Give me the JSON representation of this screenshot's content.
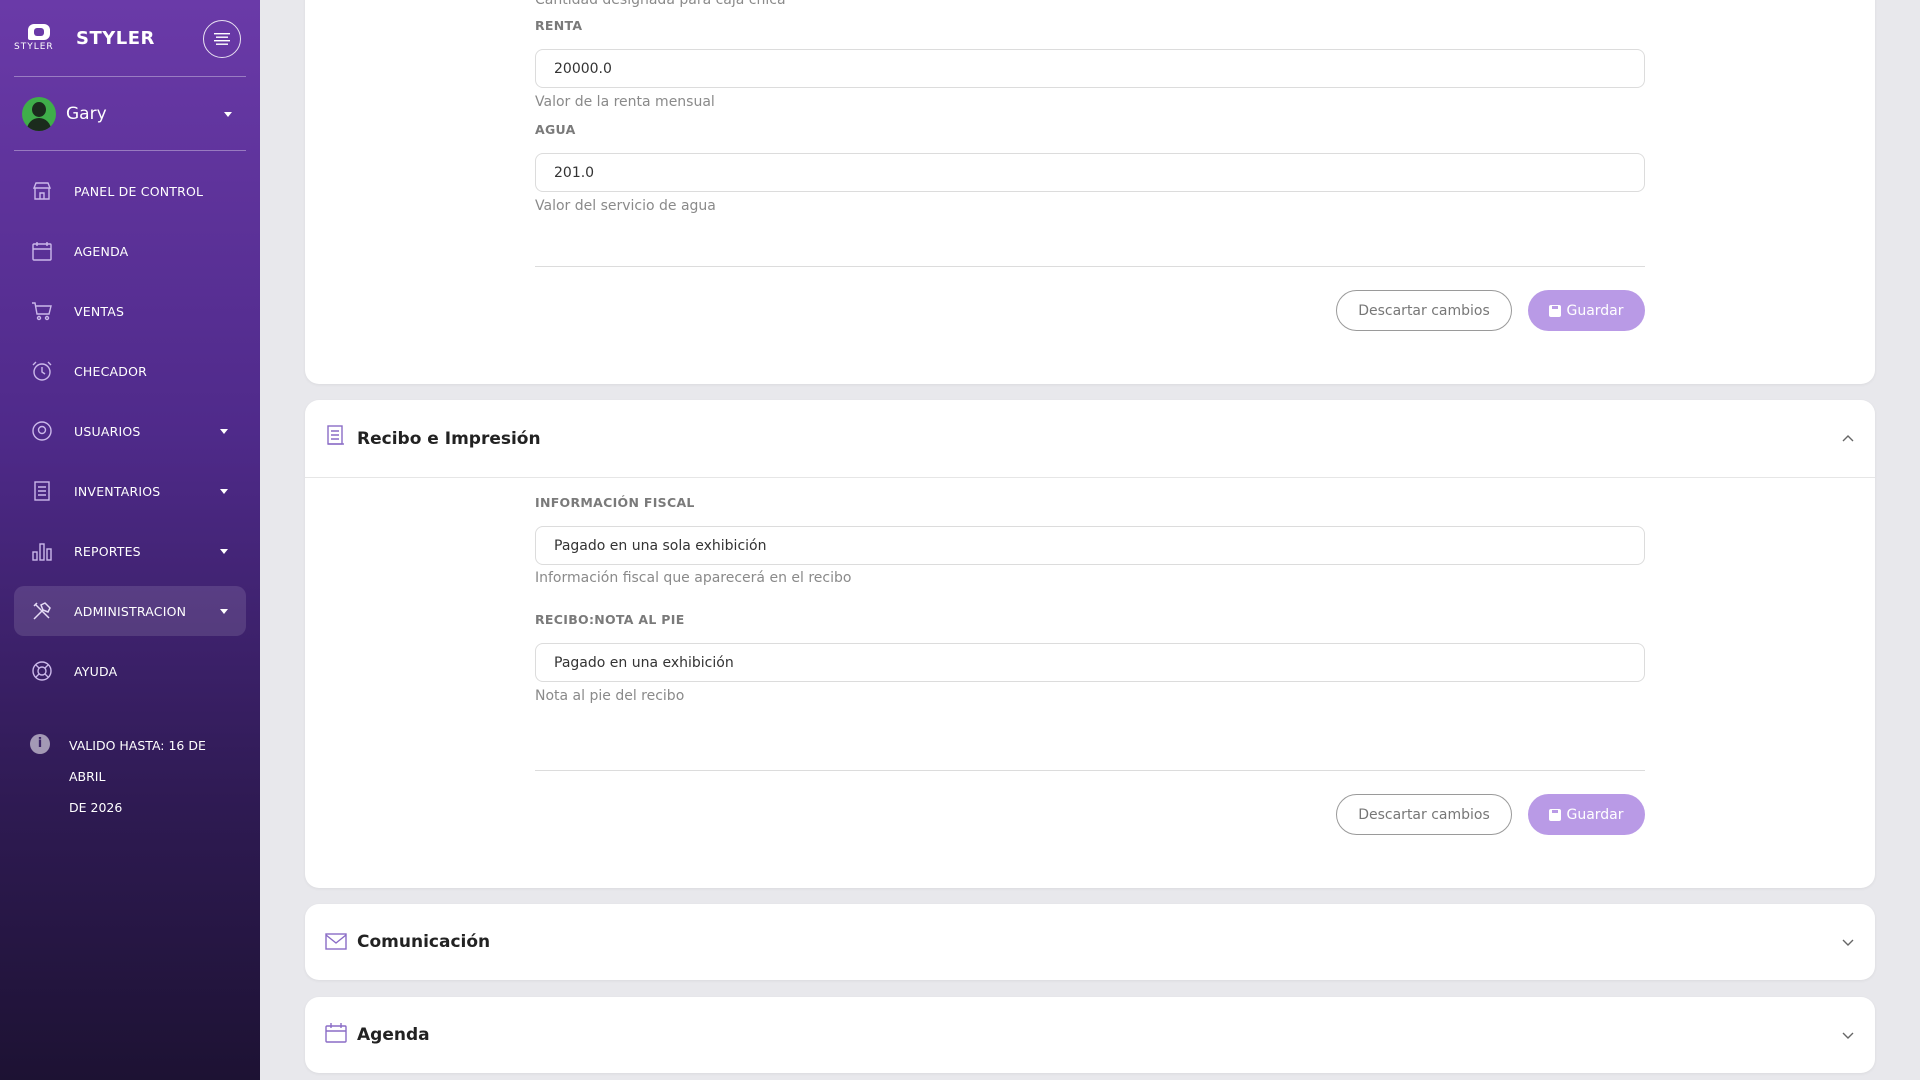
{
  "sidebar": {
    "brand": {
      "logo_text": "STYLER",
      "name": "STYLER"
    },
    "user": {
      "name": "Gary"
    },
    "nav": [
      {
        "label": "PANEL DE CONTROL",
        "icon": "store-icon",
        "has_caret": false
      },
      {
        "label": "AGENDA",
        "icon": "calendar-icon",
        "has_caret": false
      },
      {
        "label": "VENTAS",
        "icon": "cart-icon",
        "has_caret": false
      },
      {
        "label": "CHECADOR",
        "icon": "alarm-clock-icon",
        "has_caret": false
      },
      {
        "label": "USUARIOS",
        "icon": "user-circle-icon",
        "has_caret": true
      },
      {
        "label": "INVENTARIOS",
        "icon": "list-icon",
        "has_caret": true
      },
      {
        "label": "REPORTES",
        "icon": "bar-chart-icon",
        "has_caret": true
      },
      {
        "label": "ADMINISTRACION",
        "icon": "tools-icon",
        "has_caret": true,
        "active": true
      },
      {
        "label": "AYUDA",
        "icon": "lifebuoy-icon",
        "has_caret": false
      }
    ],
    "validity": {
      "line1": "VALIDO HASTA: 16 DE ABRIL",
      "line2": "DE 2026"
    }
  },
  "general_section": {
    "cut_help": "Cantidad designada para caja chica",
    "fields": [
      {
        "label": "RENTA",
        "value": "20000.0",
        "help": "Valor de la renta mensual"
      },
      {
        "label": "AGUA",
        "value": "201.0",
        "help": "Valor del servicio de agua"
      }
    ],
    "discard_label": "Descartar cambios",
    "save_label": "Guardar"
  },
  "receipt_section": {
    "title": "Recibo e Impresión",
    "expanded": true,
    "fields": [
      {
        "label": "INFORMACIÓN FISCAL",
        "value": "Pagado en una sola exhibición",
        "help": "Información fiscal que aparecerá en el recibo"
      },
      {
        "label": "RECIBO:NOTA AL PIE",
        "value": "Pagado en una exhibición",
        "help": "Nota al pie del recibo"
      }
    ],
    "discard_label": "Descartar cambios",
    "save_label": "Guardar"
  },
  "communication_section": {
    "title": "Comunicación",
    "expanded": false
  },
  "agenda_section": {
    "title": "Agenda",
    "expanded": false
  },
  "colors": {
    "accent": "#b99ae6",
    "sidebar_top": "#6a3aa8",
    "sidebar_bottom": "#1d1233"
  }
}
